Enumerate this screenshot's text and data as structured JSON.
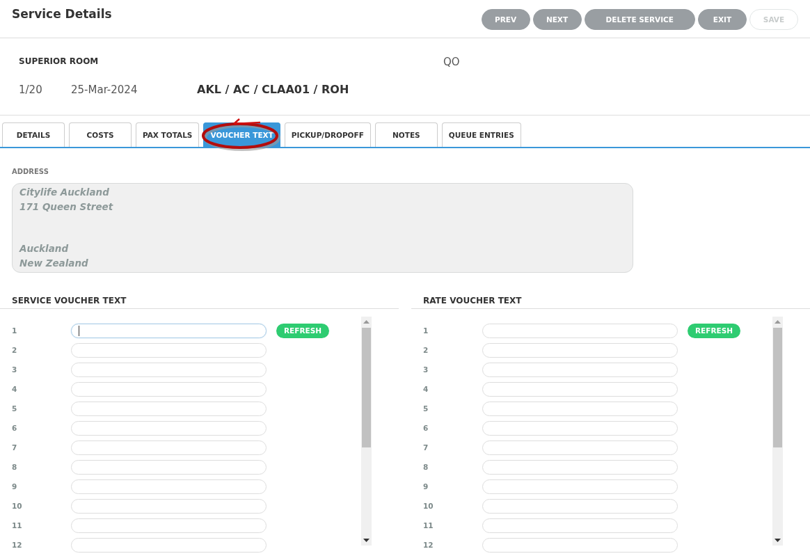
{
  "header": {
    "title": "Service Details",
    "buttons": [
      {
        "label": "PREV",
        "disabled": false
      },
      {
        "label": "NEXT",
        "disabled": false
      },
      {
        "label": "DELETE SERVICE",
        "disabled": false
      },
      {
        "label": "EXIT",
        "disabled": false
      },
      {
        "label": "SAVE",
        "disabled": true
      }
    ]
  },
  "service": {
    "name": "SUPERIOR ROOM",
    "code": "QO",
    "sequence": "1/20",
    "date": "25-Mar-2024",
    "route": "AKL / AC / CLAA01 / ROH"
  },
  "tabs": [
    {
      "label": "DETAILS",
      "selected": false,
      "circled": false
    },
    {
      "label": "COSTS",
      "selected": false,
      "circled": false
    },
    {
      "label": "PAX TOTALS",
      "selected": false,
      "circled": false
    },
    {
      "label": "VOUCHER TEXT",
      "selected": true,
      "circled": true
    },
    {
      "label": "PICKUP/DROPOFF",
      "selected": false,
      "circled": false
    },
    {
      "label": "NOTES",
      "selected": false,
      "circled": false
    },
    {
      "label": "QUEUE ENTRIES",
      "selected": false,
      "circled": false
    }
  ],
  "address": {
    "label": "ADDRESS",
    "street_lines": [
      "Citylife Auckland",
      "171 Queen Street"
    ],
    "city_lines": [
      "Auckland",
      "New Zealand"
    ]
  },
  "panels": [
    {
      "title": "SERVICE VOUCHER TEXT",
      "refresh_button": "REFRESH",
      "lines": [
        {
          "number": "1",
          "focused": true
        },
        {
          "number": "2",
          "focused": false
        },
        {
          "number": "3",
          "focused": false
        },
        {
          "number": "4",
          "focused": false
        },
        {
          "number": "5",
          "focused": false
        },
        {
          "number": "6",
          "focused": false
        },
        {
          "number": "7",
          "focused": false
        },
        {
          "number": "8",
          "focused": false
        },
        {
          "number": "9",
          "focused": false
        },
        {
          "number": "10",
          "focused": false
        },
        {
          "number": "11",
          "focused": false
        },
        {
          "number": "12",
          "focused": false
        }
      ]
    },
    {
      "title": "RATE VOUCHER TEXT",
      "refresh_button": "REFRESH",
      "lines": [
        {
          "number": "1",
          "focused": false
        },
        {
          "number": "2",
          "focused": false
        },
        {
          "number": "3",
          "focused": false
        },
        {
          "number": "4",
          "focused": false
        },
        {
          "number": "5",
          "focused": false
        },
        {
          "number": "6",
          "focused": false
        },
        {
          "number": "7",
          "focused": false
        },
        {
          "number": "8",
          "focused": false
        },
        {
          "number": "9",
          "focused": false
        },
        {
          "number": "10",
          "focused": false
        },
        {
          "number": "11",
          "focused": false
        },
        {
          "number": "12",
          "focused": false
        }
      ]
    }
  ]
}
